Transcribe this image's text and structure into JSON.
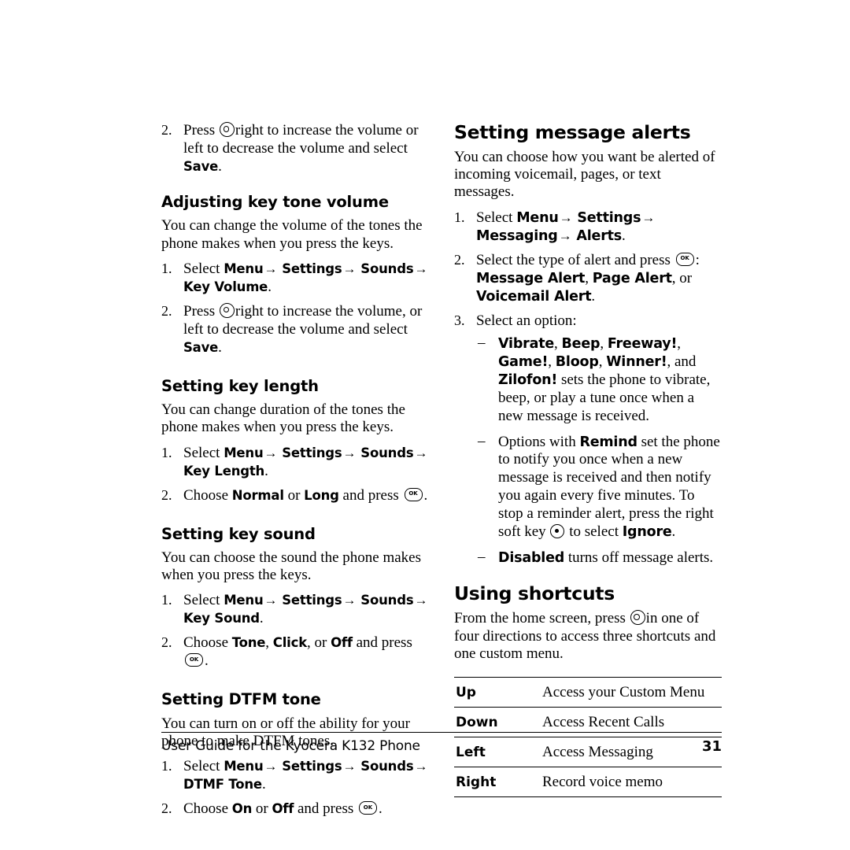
{
  "document": {
    "footer_text": "User Guide for the Kyocera K132 Phone",
    "page_number": "31"
  },
  "left_column": {
    "top_step": {
      "num": "2.",
      "t1": "Press",
      "t2": "right to increase the volume or left to decrease the volume and select",
      "t3": "Save",
      "t4": "."
    },
    "adjusting_key_tone_volume": {
      "heading": "Adjusting key tone volume",
      "body": "You can change the volume of the tones the phone makes when you press the keys.",
      "step1": {
        "num": "1.",
        "t1": "Select",
        "ui1": "Menu",
        "ui2": "Settings",
        "ui3": "Sounds",
        "ui4": "Key Volume",
        "tail": "."
      },
      "step2": {
        "num": "2.",
        "t1": "Press",
        "t2": "right to increase the volume, or left to decrease the volume and select",
        "t3": "Save",
        "t4": "."
      }
    },
    "setting_key_length": {
      "heading": "Setting key length",
      "body": "You can change duration of the tones the phone makes when you press the keys.",
      "step1": {
        "num": "1.",
        "t1": "Select",
        "ui1": "Menu",
        "ui2": "Settings",
        "ui3": "Sounds",
        "ui4": "Key Length",
        "tail": "."
      },
      "step2": {
        "num": "2.",
        "t1": "Choose",
        "ui1": "Normal",
        "t2": "or",
        "ui2": "Long",
        "t3": "and press",
        "tail": "."
      }
    },
    "setting_key_sound": {
      "heading": "Setting key sound",
      "body": "You can choose the sound the phone makes when you press the keys.",
      "step1": {
        "num": "1.",
        "t1": "Select",
        "ui1": "Menu",
        "ui2": "Settings",
        "ui3": "Sounds",
        "ui4": "Key Sound",
        "tail": "."
      },
      "step2": {
        "num": "2.",
        "t1": "Choose",
        "ui1": "Tone",
        "t2": ",",
        "ui2": "Click",
        "t3": ", or",
        "ui3": "Off",
        "t4": "and press",
        "tail": "."
      }
    },
    "setting_dtfm_tone": {
      "heading": "Setting DTFM tone",
      "body": "You can turn on or off the ability for your phone to make DTFM tones.",
      "step1": {
        "num": "1.",
        "t1": "Select",
        "ui1": "Menu",
        "ui2": "Settings",
        "ui3": "Sounds",
        "ui4": "DTMF Tone",
        "tail": "."
      },
      "step2": {
        "num": "2.",
        "t1": "Choose",
        "ui1": "On",
        "t2": "or",
        "ui2": "Off",
        "t3": "and press",
        "tail": "."
      }
    }
  },
  "right_column": {
    "setting_message_alerts": {
      "heading": "Setting message alerts",
      "body": "You can choose how you want be alerted of incoming voicemail, pages, or text messages.",
      "step1": {
        "num": "1.",
        "t1": "Select",
        "ui1": "Menu",
        "ui2": "Settings",
        "ui3": "Messaging",
        "ui4": "Alerts",
        "tail": "."
      },
      "step2": {
        "num": "2.",
        "t1": "Select the type of alert and press",
        "t2": ":",
        "ui1": "Message Alert",
        "t3": ",",
        "ui2": "Page Alert",
        "t4": ", or",
        "ui3": "Voicemail Alert",
        "tail": "."
      },
      "step3": {
        "num": "3.",
        "t1": "Select an option:"
      },
      "options": [
        {
          "ui1": "Vibrate",
          "s1": ",",
          "ui2": "Beep",
          "s2": ",",
          "ui3": "Freeway!",
          "s3": ",",
          "ui4": "Game!",
          "s4": ",",
          "ui5": "Bloop",
          "s5": ",",
          "ui6": "Winner!",
          "s6": ", and",
          "ui7": "Zilofon!",
          "tail": "sets the phone to vibrate, beep, or play a tune once when a new message is received."
        },
        {
          "t1": "Options with",
          "ui1": "Remind",
          "t2": "set the phone to notify you once when a new message is received and then notify you again every five minutes. To stop a reminder alert, press the right soft key",
          "t3": "to select",
          "ui2": "Ignore",
          "tail": "."
        },
        {
          "ui1": "Disabled",
          "tail": "turns off message alerts."
        }
      ]
    },
    "using_shortcuts": {
      "heading": "Using shortcuts",
      "body_pre": "From the home screen, press",
      "body_post": "in one of four directions to access three shortcuts and one custom menu.",
      "table": {
        "rows": [
          {
            "key": "Up",
            "value": "Access your Custom Menu"
          },
          {
            "key": "Down",
            "value": "Access Recent Calls"
          },
          {
            "key": "Left",
            "value": "Access Messaging"
          },
          {
            "key": "Right",
            "value": "Record voice memo"
          }
        ]
      }
    }
  },
  "icons": {
    "nav_key": "nav-key-icon",
    "ok_key": "ok-key-icon",
    "soft_key": "soft-key-icon",
    "arrow": "→"
  }
}
